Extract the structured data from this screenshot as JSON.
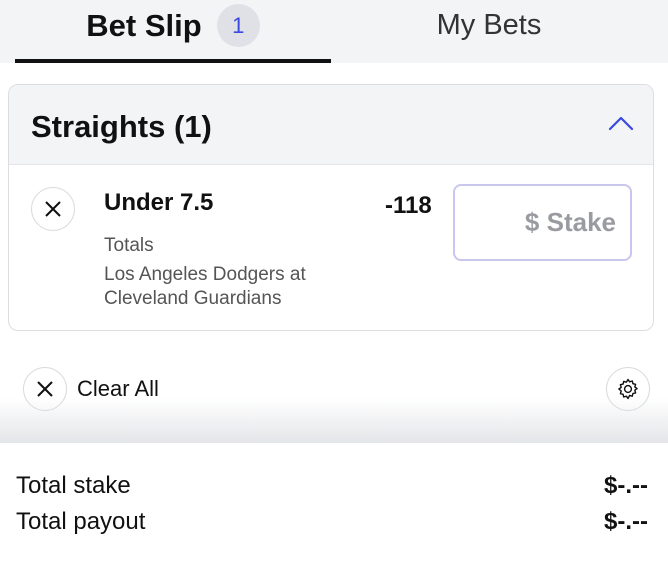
{
  "tabs": {
    "bet_slip": "Bet Slip",
    "bet_slip_count": "1",
    "my_bets": "My Bets"
  },
  "straights": {
    "title": "Straights (1)",
    "selection": {
      "name": "Under 7.5",
      "market": "Totals",
      "event": "Los Angeles Dodgers at Cleveland Guardians",
      "odds": "-118",
      "stake_placeholder": "$ Stake",
      "stake_value": ""
    }
  },
  "actions": {
    "clear_all": "Clear All"
  },
  "totals": {
    "stake_label": "Total stake",
    "stake_value": "$-.--",
    "payout_label": "Total payout",
    "payout_value": "$-.--"
  },
  "icons": {
    "collapse": "chevron-up-icon",
    "remove": "close-icon",
    "clear": "close-icon",
    "settings": "gear-icon"
  },
  "colors": {
    "accent": "#3b49df",
    "badge_bg": "#dfe1e6",
    "header_bg": "#f3f4f6",
    "stake_border": "#c9c7ec"
  }
}
